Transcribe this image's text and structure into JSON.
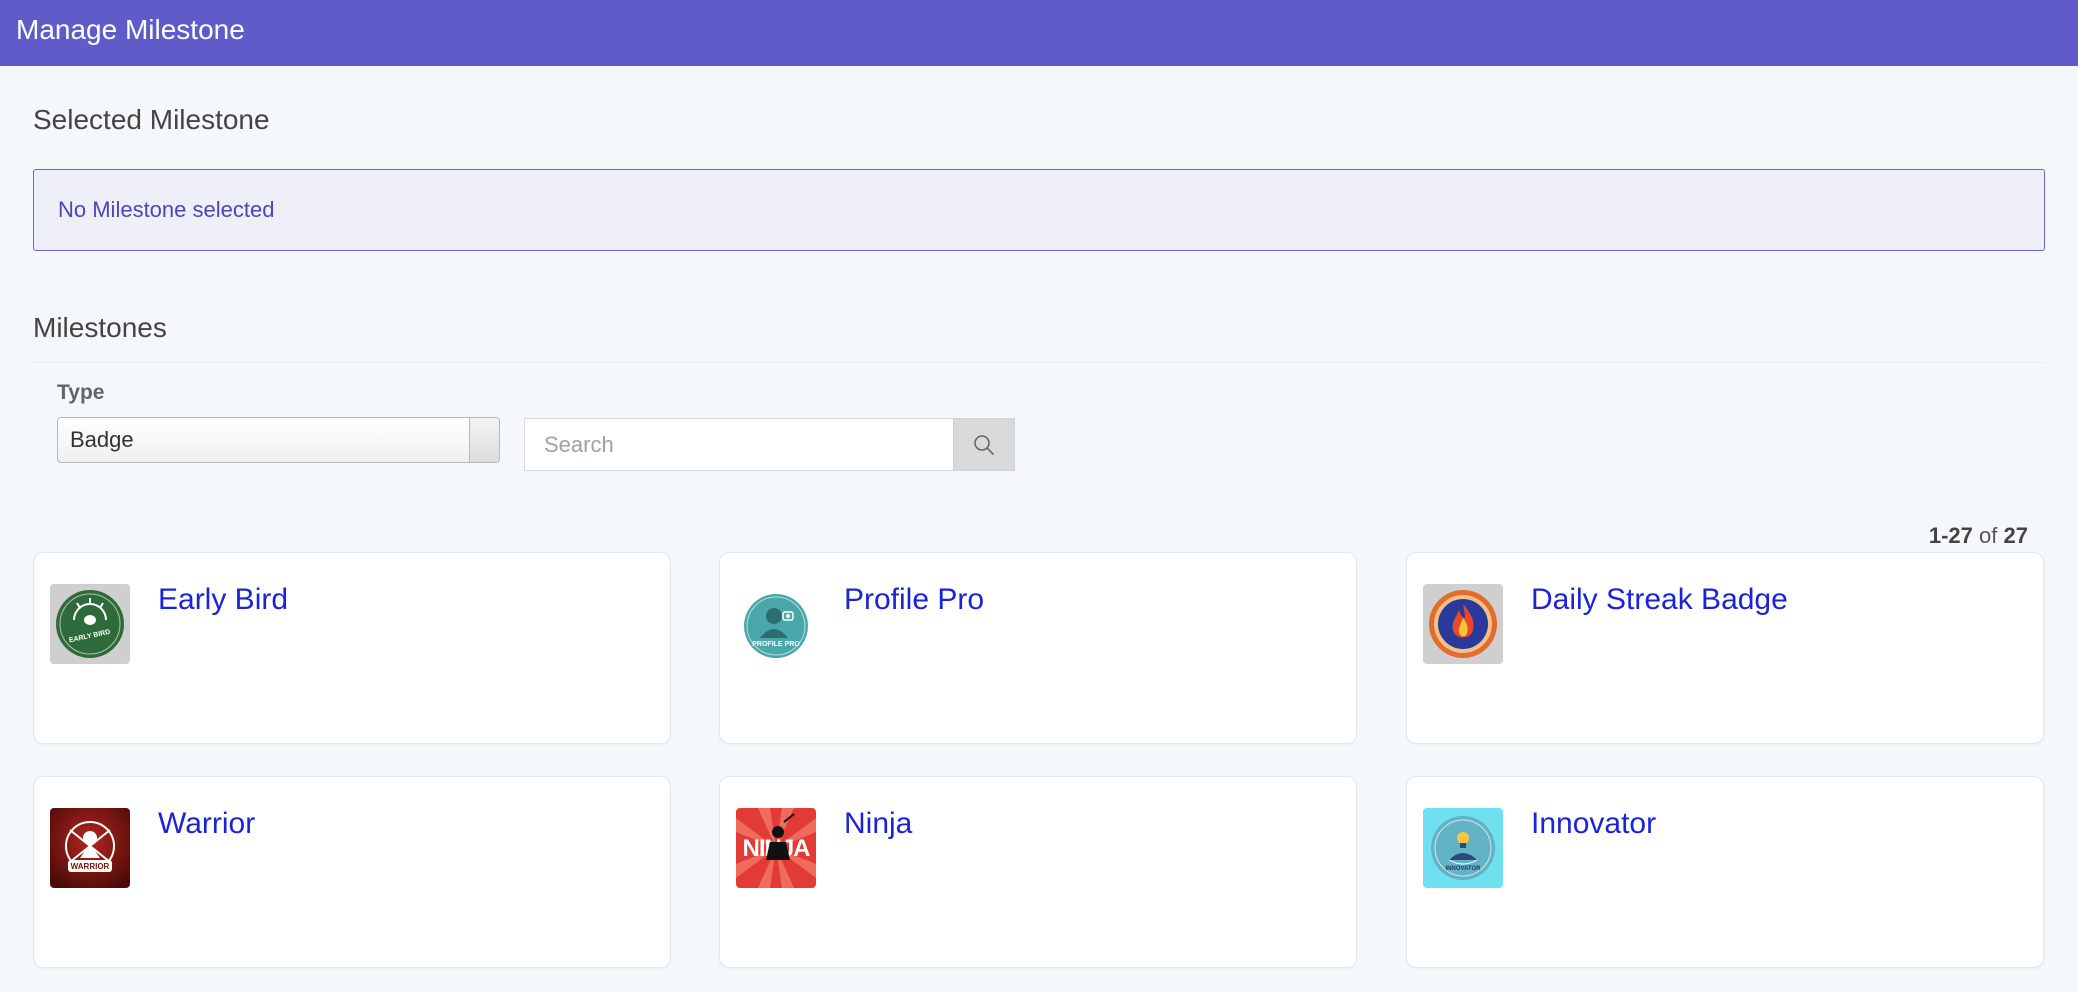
{
  "header": {
    "title": "Manage Milestone"
  },
  "selected": {
    "title": "Selected Milestone",
    "message": "No Milestone selected"
  },
  "milestones": {
    "title": "Milestones",
    "type_label": "Type",
    "type_value": "Badge",
    "search_placeholder": "Search",
    "pager": {
      "start": "1",
      "end": "27",
      "of": "of",
      "total": "27"
    },
    "cards": [
      {
        "name": "Early Bird",
        "icon": "early-bird-badge",
        "badge_text": "EARLY BIRD"
      },
      {
        "name": "Profile Pro",
        "icon": "profile-pro-badge",
        "badge_text": "PROFILE PRO"
      },
      {
        "name": "Daily Streak Badge",
        "icon": "daily-streak-badge"
      },
      {
        "name": "Warrior",
        "icon": "warrior-badge",
        "badge_text": "WARRIOR"
      },
      {
        "name": "Ninja",
        "icon": "ninja-badge",
        "badge_text": "NINJA"
      },
      {
        "name": "Innovator",
        "icon": "innovator-badge",
        "badge_text": "INNOVATOR"
      }
    ]
  },
  "colors": {
    "header_bg": "#5f5bc8",
    "alert_bg": "#efeff9",
    "alert_border": "#6a66cf",
    "link": "#1a24d6"
  }
}
